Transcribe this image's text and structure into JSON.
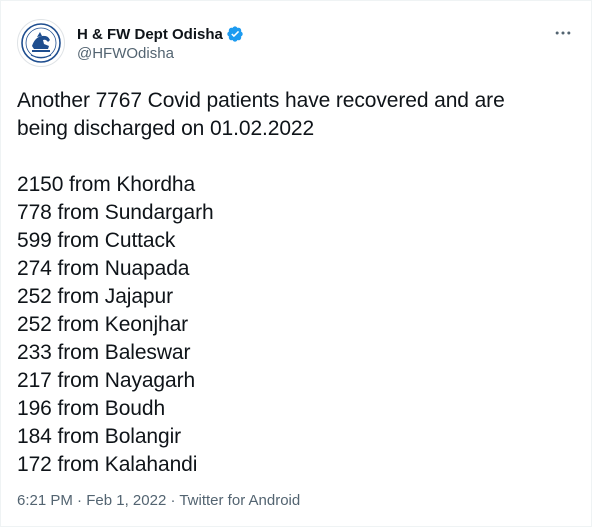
{
  "author": {
    "display_name": "H & FW Dept Odisha",
    "handle": "@HFWOdisha",
    "verified": true,
    "avatar_icon": "odisha-emblem-icon"
  },
  "tweet": {
    "intro_line1": "Another 7767 Covid patients have recovered and are",
    "intro_line2": "being discharged on 01.02.2022",
    "districts": [
      "2150 from Khordha",
      "778 from Sundargarh",
      "599 from Cuttack",
      "274 from Nuapada",
      "252 from Jajapur",
      "252 from Keonjhar",
      "233 from Baleswar",
      "217 from Nayagarh",
      "196 from Boudh",
      "184 from Bolangir",
      "172 from Kalahandi"
    ]
  },
  "meta": {
    "time": "6:21 PM",
    "separator": " · ",
    "date": "Feb 1, 2022",
    "source": "Twitter for Android"
  },
  "colors": {
    "text": "#0f1419",
    "secondary": "#536471",
    "verified_badge": "#1d9bf0",
    "emblem": "#1f4e8f"
  },
  "icons": {
    "more": "more-options-icon",
    "verified": "verified-badge-icon"
  }
}
